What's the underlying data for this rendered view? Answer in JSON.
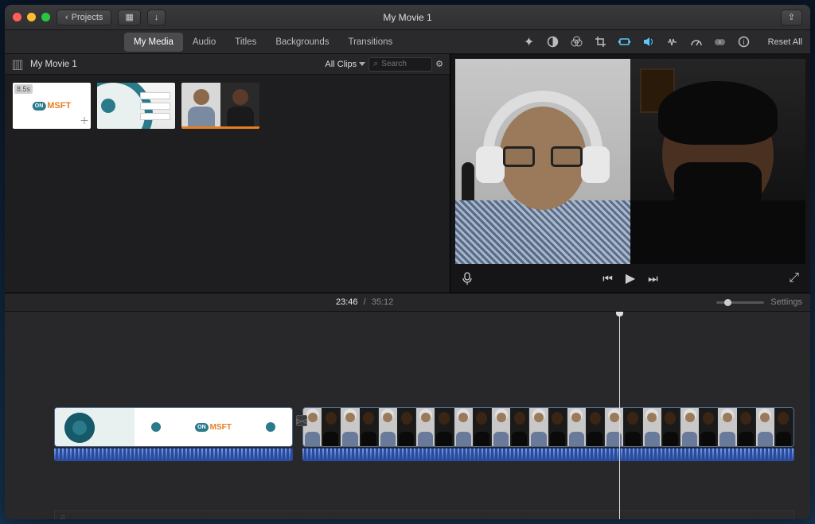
{
  "window": {
    "title": "My Movie 1",
    "back_label": "Projects"
  },
  "tabs": [
    "My Media",
    "Audio",
    "Titles",
    "Backgrounds",
    "Transitions"
  ],
  "active_tab": 0,
  "toolbar": {
    "reset_label": "Reset All"
  },
  "browser": {
    "project_name": "My Movie 1",
    "filter_label": "All Clips",
    "search_placeholder": "Search",
    "clip1_duration": "8.5s",
    "clip1_brand_on": "ON",
    "clip1_brand_name": "MSFT"
  },
  "playback": {
    "current_time": "23:46",
    "total_time": "35:12"
  },
  "timeline": {
    "settings_label": "Settings",
    "brand_on": "ON",
    "brand_name": "MSFT",
    "transition_glyph": "▷◁"
  },
  "icons": {
    "chevron_left": "‹",
    "download": "↓",
    "share": "⇪",
    "wand": "✦",
    "mic": "🎤",
    "prev": "⏮",
    "play": "▶",
    "next": "⏭",
    "fullscreen": "⤢",
    "gear": "⚙",
    "search": "⌕",
    "sidebar": "▥",
    "viewmode": "▦",
    "music": "♫",
    "plus": "＋"
  }
}
